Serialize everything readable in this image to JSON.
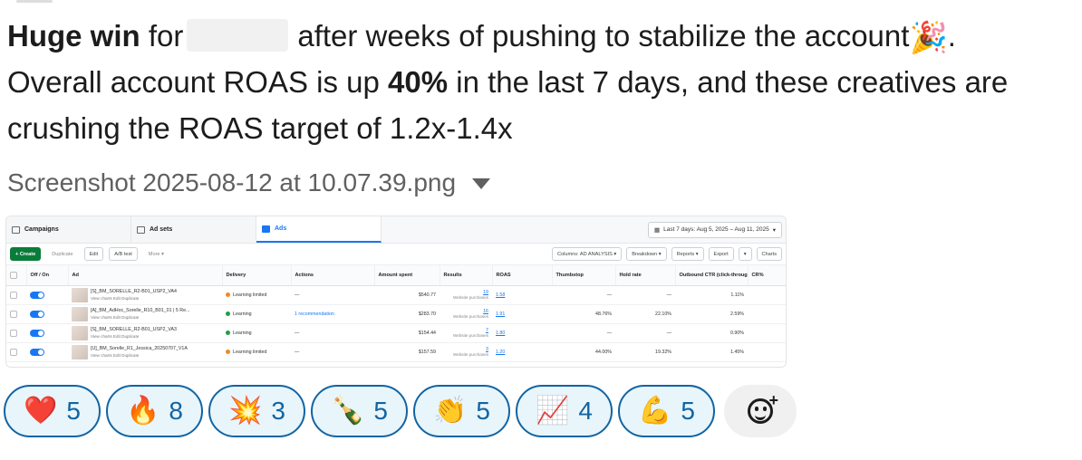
{
  "message": {
    "p1_bold": "Huge win",
    "p1_for": "for",
    "p1_rest": "after weeks of pushing to stabilize the account",
    "p1_emoji": "🎉",
    "p1_end": ".",
    "p2_start": "Overall account ROAS is up",
    "p2_bold": "40%",
    "p2_rest": "in the last 7 days, and these creatives are crushing the ROAS target of 1.2x-1.4x"
  },
  "attachment": {
    "filename": "Screenshot 2025-08-12 at 10.07.39.png"
  },
  "shot": {
    "tabs": [
      "Campaigns",
      "Ad sets",
      "Ads"
    ],
    "date_range": "Last 7 days: Aug 5, 2025 – Aug 11, 2025",
    "toolbar_left": [
      "+ Create",
      "Duplicate",
      "Edit",
      "A/B test",
      "More ▾"
    ],
    "toolbar_right": [
      "Columns: AD ANALYSIS ▾",
      "Breakdown ▾",
      "Reports ▾",
      "Export",
      "▾",
      "Charts"
    ],
    "headers": [
      "Off / On",
      "Ad",
      "Delivery",
      "Actions",
      "Amount spent",
      "Results",
      "ROAS",
      "Thumbstop",
      "Hold rate",
      "Outbound CTR (click-through...",
      "CR%"
    ],
    "row_sub": "View charts  Edit  Duplicate",
    "results_sub": "Website purchases",
    "rows": [
      {
        "ad": "[S]_BM_SORELLE_R2-B01_USP2_VA4",
        "delivery": "Learning limited",
        "delivery_status": "orange",
        "actions": "—",
        "spent": "$540.77",
        "results": "19",
        "roas": "1.58",
        "thumbstop": "—",
        "hold": "—",
        "ctr": "1.11%"
      },
      {
        "ad": "[A]_BM_AdHoc_Sorelle_R10_B01_01 | 5 Re...",
        "delivery": "Learning",
        "delivery_status": "green",
        "actions": "1 recommendation",
        "spent": "$283.70",
        "results": "16",
        "roas": "1.91",
        "thumbstop": "48.76%",
        "hold": "22.10%",
        "ctr": "2.59%"
      },
      {
        "ad": "[S]_BM_SORELLE_R2-B01_USP2_VA3",
        "delivery": "Learning",
        "delivery_status": "green",
        "actions": "—",
        "spent": "$154.44",
        "results": "7",
        "roas": "1.80",
        "thumbstop": "—",
        "hold": "—",
        "ctr": "0.90%"
      },
      {
        "ad": "[U]_BM_Sorelle_R1_Jessica_20250707_V1A",
        "delivery": "Learning limited",
        "delivery_status": "orange",
        "actions": "—",
        "spent": "$157.59",
        "results": "3",
        "roas": "1.20",
        "thumbstop": "44.00%",
        "hold": "19.32%",
        "ctr": "1.45%"
      }
    ]
  },
  "reactions": [
    {
      "emoji": "❤️",
      "icon": "red-heart-icon",
      "count": "5"
    },
    {
      "emoji": "🔥",
      "icon": "fire-icon",
      "count": "8"
    },
    {
      "emoji": "💥",
      "icon": "collision-icon",
      "count": "3"
    },
    {
      "emoji": "🍾",
      "icon": "champagne-icon",
      "count": "5"
    },
    {
      "emoji": "👏",
      "icon": "clapping-hands-icon",
      "count": "5"
    },
    {
      "emoji": "📈",
      "icon": "chart-increasing-icon",
      "count": "4"
    },
    {
      "emoji": "💪",
      "icon": "flexed-biceps-icon",
      "count": "5"
    }
  ],
  "colors": {
    "reaction_border": "#1264a3",
    "reaction_bg": "#e8f5fa",
    "meta_blue": "#1877f2",
    "create_green": "#0a7c3a"
  }
}
